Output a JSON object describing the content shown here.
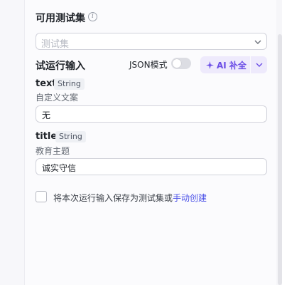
{
  "test_sets": {
    "title": "可用测试集",
    "info_icon": "info-icon",
    "select_placeholder": "测试集"
  },
  "trial_input": {
    "title": "试运行输入",
    "json_mode_label": "JSON模式",
    "json_mode_enabled": false,
    "ai_fill_label": "AI 补全",
    "accent_color": "#6b4de6"
  },
  "fields": [
    {
      "name": "text",
      "type": "String",
      "description": "自定义文案",
      "value": "无"
    },
    {
      "name": "title",
      "type": "String",
      "description": "教育主题",
      "value": "诚实守信"
    }
  ],
  "save_option": {
    "checked": false,
    "label": "将本次运行输入保存为测试集或",
    "link": "手动创建"
  }
}
